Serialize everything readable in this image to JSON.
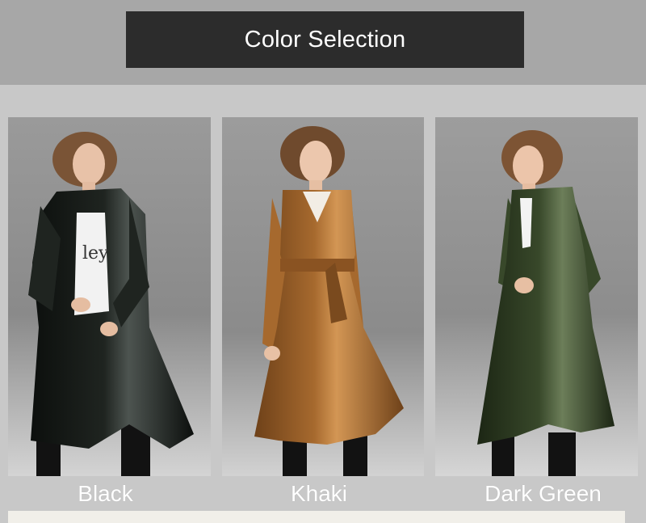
{
  "header": {
    "title": "Color Selection"
  },
  "colors": {
    "header_bar": "#2c2c2c",
    "page_band": "#a7a7a7",
    "panel": "#c8c8c8",
    "label_text": "#ffffff"
  },
  "options": [
    {
      "label": "Black",
      "coat_color": "#1f2420",
      "coat_shadow": "#0c0f0d",
      "coat_highlight": "#4d5450",
      "icon": "black-leather-coat-photo"
    },
    {
      "label": "Khaki",
      "coat_color": "#a6692e",
      "coat_shadow": "#6e4119",
      "coat_highlight": "#d39654",
      "icon": "khaki-leather-coat-photo"
    },
    {
      "label": "Dark Green",
      "coat_color": "#38482a",
      "coat_shadow": "#1c2614",
      "coat_highlight": "#6c7e59",
      "icon": "dark-green-leather-coat-photo"
    }
  ]
}
